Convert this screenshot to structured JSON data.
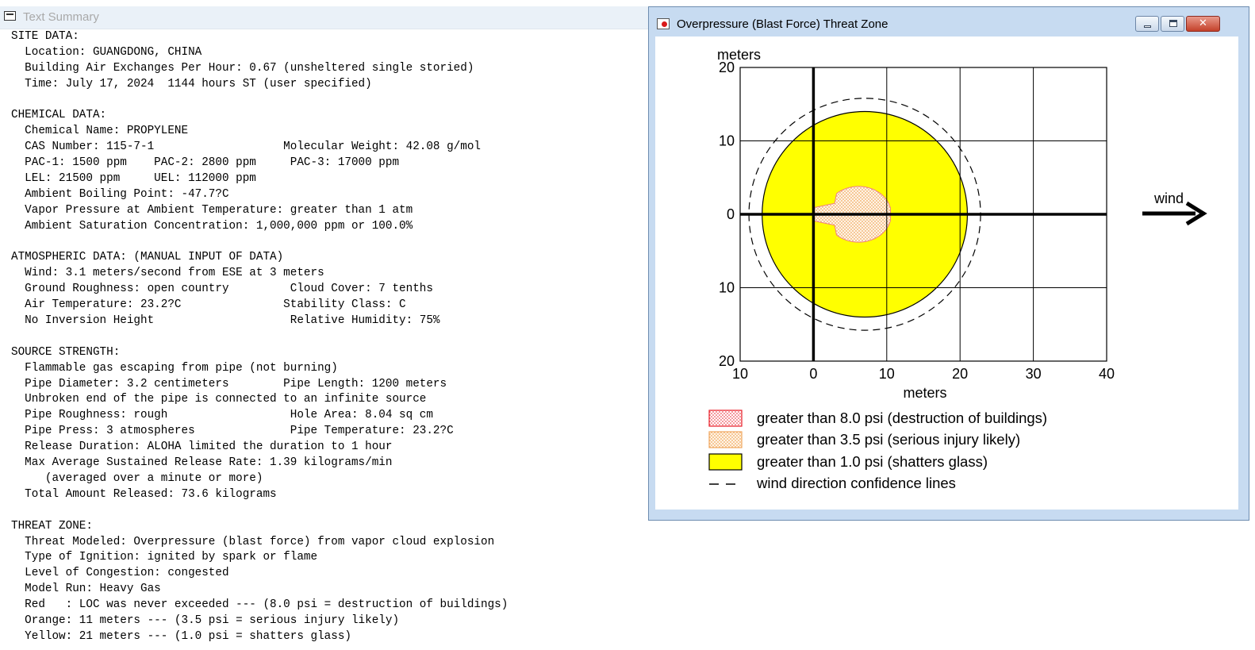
{
  "text_summary": {
    "title": "Text Summary",
    "lines": [
      "SITE DATA:",
      "  Location: GUANGDONG, CHINA",
      "  Building Air Exchanges Per Hour: 0.67 (unsheltered single storied)",
      "  Time: July 17, 2024  1144 hours ST (user specified)",
      "",
      "CHEMICAL DATA:",
      "  Chemical Name: PROPYLENE",
      "  CAS Number: 115-7-1                   Molecular Weight: 42.08 g/mol",
      "  PAC-1: 1500 ppm    PAC-2: 2800 ppm     PAC-3: 17000 ppm",
      "  LEL: 21500 ppm     UEL: 112000 ppm",
      "  Ambient Boiling Point: -47.7?C",
      "  Vapor Pressure at Ambient Temperature: greater than 1 atm",
      "  Ambient Saturation Concentration: 1,000,000 ppm or 100.0%",
      "",
      "ATMOSPHERIC DATA: (MANUAL INPUT OF DATA)",
      "  Wind: 3.1 meters/second from ESE at 3 meters",
      "  Ground Roughness: open country         Cloud Cover: 7 tenths",
      "  Air Temperature: 23.2?C               Stability Class: C",
      "  No Inversion Height                    Relative Humidity: 75%",
      "",
      "SOURCE STRENGTH:",
      "  Flammable gas escaping from pipe (not burning)",
      "  Pipe Diameter: 3.2 centimeters        Pipe Length: 1200 meters",
      "  Unbroken end of the pipe is connected to an infinite source",
      "  Pipe Roughness: rough                  Hole Area: 8.04 sq cm",
      "  Pipe Press: 3 atmospheres              Pipe Temperature: 23.2?C",
      "  Release Duration: ALOHA limited the duration to 1 hour",
      "  Max Average Sustained Release Rate: 1.39 kilograms/min",
      "     (averaged over a minute or more)",
      "  Total Amount Released: 73.6 kilograms",
      "",
      "THREAT ZONE:",
      "  Threat Modeled: Overpressure (blast force) from vapor cloud explosion",
      "  Type of Ignition: ignited by spark or flame",
      "  Level of Congestion: congested",
      "  Model Run: Heavy Gas",
      "  Red   : LOC was never exceeded --- (8.0 psi = destruction of buildings)",
      "  Orange: 11 meters --- (3.5 psi = serious injury likely)",
      "  Yellow: 21 meters --- (1.0 psi = shatters glass)"
    ]
  },
  "threat_window": {
    "title": "Overpressure (Blast Force) Threat Zone",
    "buttons": {
      "minimize": "minimize",
      "maximize": "maximize",
      "close": "close"
    }
  },
  "chart_data": {
    "type": "area",
    "title": "",
    "xlabel": "meters",
    "ylabel": "meters",
    "xlim": [
      -10,
      40
    ],
    "ylim": [
      -20,
      20
    ],
    "x_ticks": [
      -10,
      0,
      10,
      20,
      30,
      40
    ],
    "y_ticks": [
      20,
      10,
      0,
      -10,
      -20
    ],
    "x_tick_labels": [
      "10",
      "0",
      "10",
      "20",
      "30",
      "40"
    ],
    "y_tick_labels": [
      "20",
      "10",
      "0",
      "10",
      "20"
    ],
    "grid": true,
    "wind_label": "wind",
    "zones": [
      {
        "name": "greater than 8.0 psi (destruction of buildings)",
        "color": "#e8202a",
        "fill": "dotted",
        "extent_m": 0
      },
      {
        "name": "greater than 3.5 psi (serious injury likely)",
        "color": "#f5c48a",
        "fill": "dotted",
        "extent_m": 11
      },
      {
        "name": "greater than 1.0 psi (shatters glass)",
        "color": "#ffff00",
        "fill": "solid",
        "extent_m": 21
      },
      {
        "name": "wind direction confidence lines",
        "color": "#000000",
        "fill": "dashed"
      }
    ],
    "yellow_zone": {
      "center_x": 7,
      "center_y": 0,
      "radius": 14
    },
    "confidence_circle": {
      "center_x": 7,
      "center_y": 0,
      "radius": 15.8
    },
    "orange_zone": {
      "x_start": 0,
      "x_end": 10.5,
      "max_half_width": 3.8
    }
  }
}
